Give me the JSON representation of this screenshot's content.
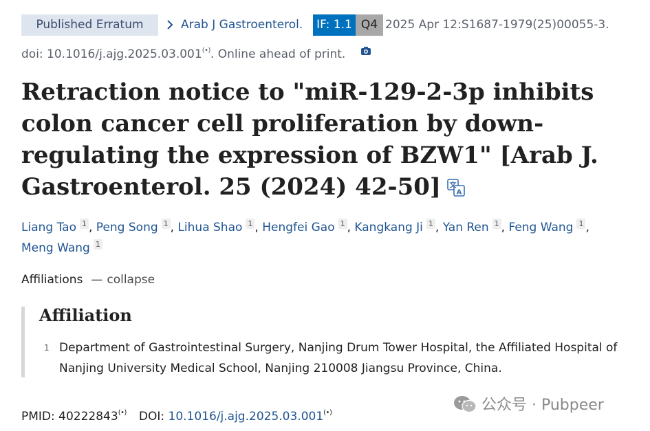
{
  "header": {
    "article_type_badge": "Published Erratum",
    "journal": "Arab J Gastroenterol.",
    "impact_factor": "IF: 1.1",
    "quartile": "Q4",
    "citation": "2025 Apr 12:S1687-1979(25)00055-3.",
    "doi_prefix": "doi: 10.1016/j.ajg.2025.03.001",
    "doi_suffix": ". Online ahead of print.",
    "altmetric_mark": "(•)"
  },
  "article": {
    "title": "Retraction notice to \"miR-129-2-3p inhibits colon cancer cell proliferation by down-regulating the expression of BZW1\" [Arab J. Gastroenterol. 25 (2024) 42-50]"
  },
  "authors": [
    {
      "name": "Liang Tao",
      "aff": "1"
    },
    {
      "name": "Peng Song",
      "aff": "1"
    },
    {
      "name": "Lihua Shao",
      "aff": "1"
    },
    {
      "name": "Hengfei Gao",
      "aff": "1"
    },
    {
      "name": "Kangkang Ji",
      "aff": "1"
    },
    {
      "name": "Yan Ren",
      "aff": "1"
    },
    {
      "name": "Feng Wang",
      "aff": "1"
    },
    {
      "name": "Meng Wang",
      "aff": "1"
    }
  ],
  "affiliations_toggle": {
    "label": "Affiliations",
    "dash": "—",
    "action": "collapse"
  },
  "affiliation_box": {
    "heading": "Affiliation",
    "items": [
      {
        "num": "1",
        "line1": "Department of Gastrointestinal Surgery, Nanjing Drum Tower Hospital, the Affiliated Hospital of",
        "line2": "Nanjing University Medical School, Nanjing 210008 Jiangsu Province, China."
      }
    ]
  },
  "footer": {
    "pmid_label": "PMID: 40222843",
    "doi_label": "DOI: ",
    "doi_value": "10.1016/j.ajg.2025.03.001",
    "altmetric_mark": "(•)"
  },
  "watermark": {
    "text": "公众号 · Pubpeer"
  },
  "colors": {
    "link": "#205493",
    "if_badge": "#0071bc",
    "quartile_badge": "#a8a8a8",
    "type_badge_bg": "#dfe5ee"
  }
}
